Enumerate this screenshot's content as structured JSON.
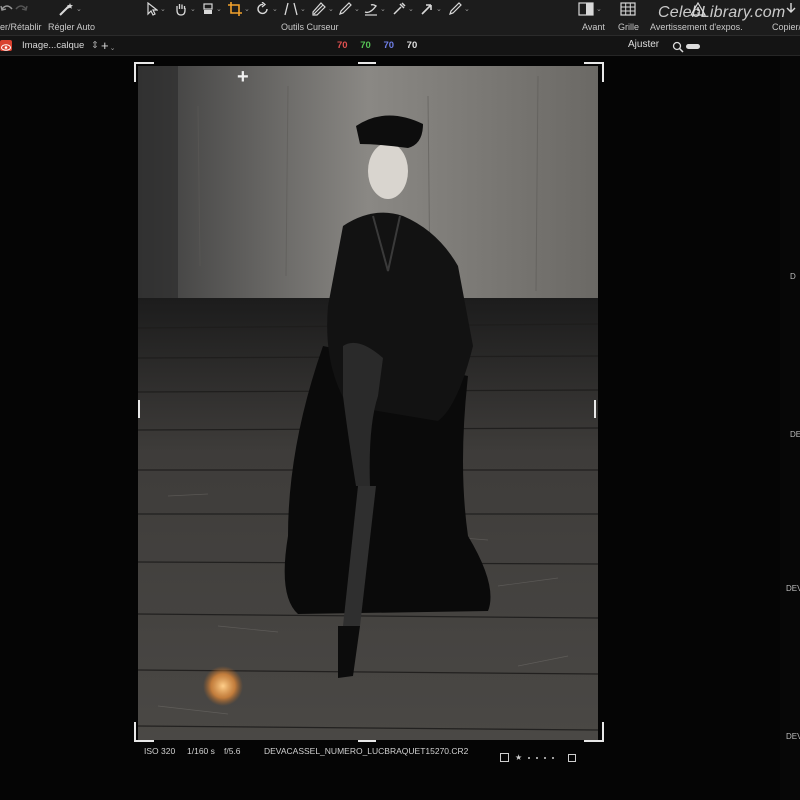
{
  "toolbar": {
    "undo_label": "er/Rétablir",
    "auto_adjust_label": "Régler Auto",
    "cursor_tools_label": "Outils Curseur",
    "before_label": "Avant",
    "grid_label": "Grille",
    "exposure_warning_label": "Avertissement d'expos.",
    "copy_label": "Copier/",
    "icons": [
      "undo-icon",
      "redo-icon",
      "magic-wand-icon",
      "pointer-icon",
      "hand-icon",
      "brush-icon",
      "crop-icon",
      "rotate-icon",
      "perspective-icon",
      "erase-icon",
      "pen-icon",
      "eyedropper-icon",
      "arrow-pick-icon",
      "pencil-icon",
      "compare-icon",
      "grid-icon",
      "warning-icon",
      "copy-icon"
    ]
  },
  "watermark": "CelebLibrary.com",
  "subbar": {
    "layer_select": "Image...calque",
    "readouts": [
      {
        "value": "70",
        "color": "#e05050"
      },
      {
        "value": "70",
        "color": "#55c255"
      },
      {
        "value": "70",
        "color": "#6f7fe8"
      },
      {
        "value": "70",
        "color": "#e0e0e0"
      }
    ],
    "adjust_label": "Ajuster"
  },
  "photo": {
    "iso": "ISO 320",
    "shutter": "1/160 s",
    "aperture": "f/5.6",
    "filename": "DEVACASSEL_NUMERO_LUCBRAQUET15270.CR2",
    "rating": "★"
  },
  "right_panel": {
    "labels": [
      "D",
      "DEV",
      "DEVA",
      "DEVA"
    ]
  },
  "colors": {
    "accent_red": "#d9412f",
    "toolbar_bg": "#1c1c1c",
    "viewer_bg": "#050505"
  }
}
